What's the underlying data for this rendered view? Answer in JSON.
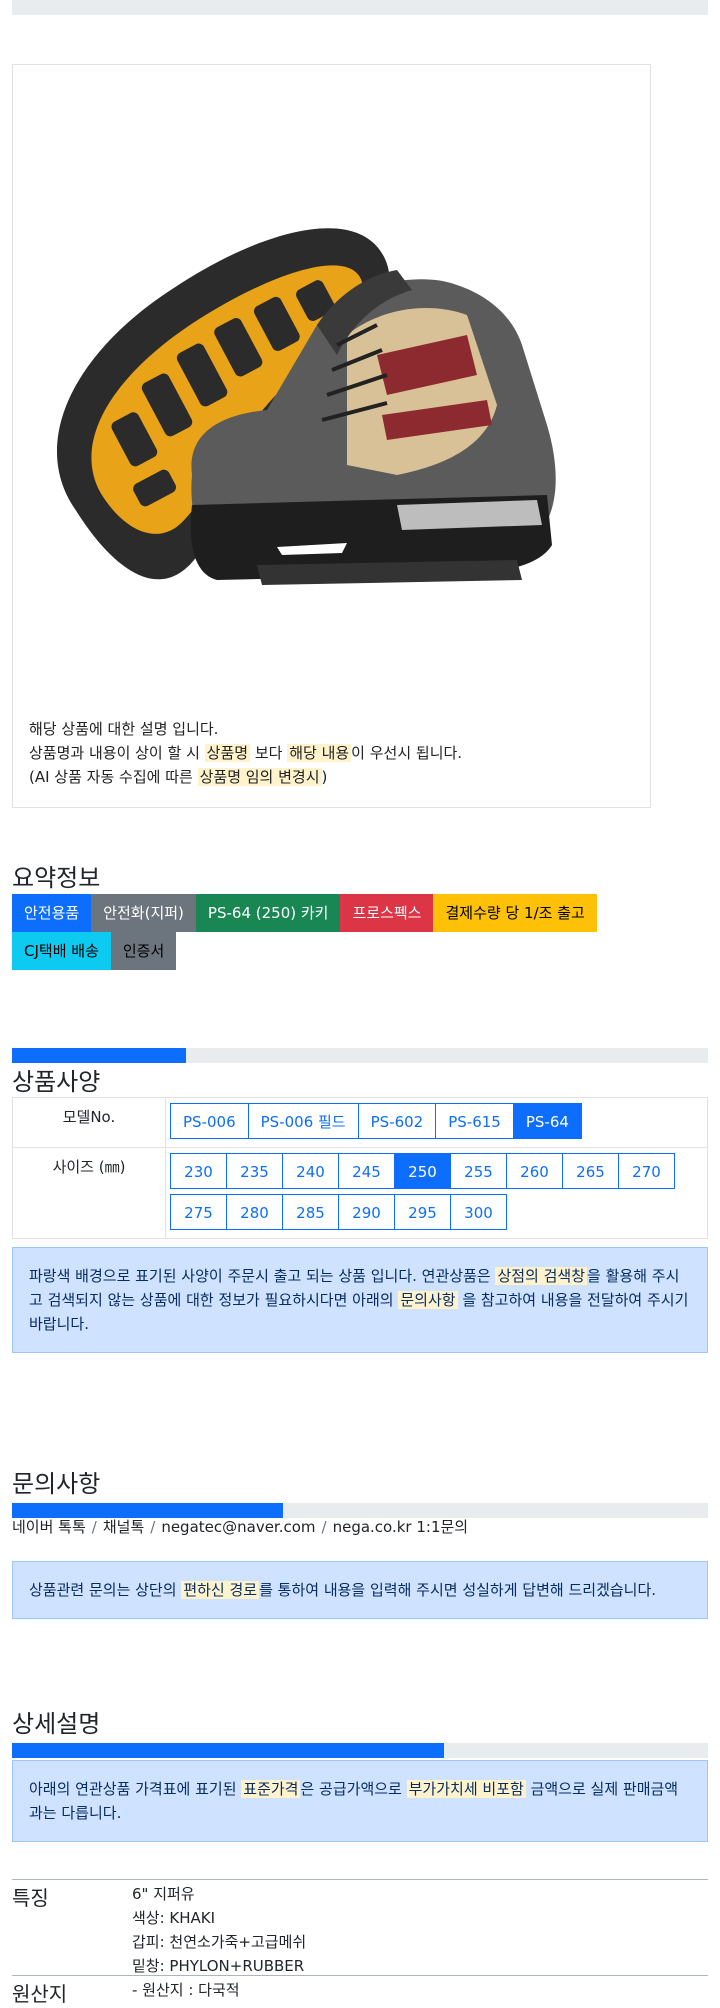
{
  "product": {
    "image_alt": "",
    "desc_line1": "해당 상품에 대한 설명 입니다.",
    "desc_line2_a": "상품명과 내용이 상이 할 시 ",
    "desc_line2_hl1": "상품명",
    "desc_line2_b": " 보다 ",
    "desc_line2_hl2": "해당 내용",
    "desc_line2_c": "이 우선시 됩니다.",
    "desc_line3_a": "(AI 상품 자동 수집에 따른 ",
    "desc_line3_hl": "상품명 임의 변경시",
    "desc_line3_b": ")"
  },
  "summary": {
    "title": "요약정보",
    "badges": [
      {
        "label": "안전용품",
        "color": "#0d6efd"
      },
      {
        "label": "안전화(지퍼)",
        "color": "#6c757d"
      },
      {
        "label": "PS-64 (250) 카키",
        "color": "#198754"
      },
      {
        "label": "프로스펙스",
        "color": "#dc3545"
      },
      {
        "label": "결제수량 당 1/조 출고",
        "color": "#ffc107"
      },
      {
        "label": "CJ택배 배송",
        "color": "#0dcaf0"
      },
      {
        "label": "인증서",
        "color": "#6c757d"
      }
    ]
  },
  "spec": {
    "title": "상품사양",
    "progress": 0.25,
    "model_label": "모델No.",
    "models": [
      "PS-006",
      "PS-006 필드",
      "PS-602",
      "PS-615",
      "PS-64"
    ],
    "model_selected": "PS-64",
    "size_label": "사이즈 (㎜)",
    "sizes": [
      "230",
      "235",
      "240",
      "245",
      "250",
      "255",
      "260",
      "265",
      "270",
      "275",
      "280",
      "285",
      "290",
      "295",
      "300"
    ],
    "size_selected": "250",
    "notice_a": "파랑색 배경으로 표기된 사양이 주문시 출고 되는 상품 입니다. 연관상품은 ",
    "notice_hl1": "상점의 검색창",
    "notice_b": "을 활용해 주시고 검색되지 않는 상품에 대한 정보가 필요하시다면 아래의 ",
    "notice_hl2": "문의사항",
    "notice_c": " 을 참고하여 내용을 전달하여 주시기 바랍니다."
  },
  "inquiry": {
    "title": "문의사항",
    "progress": 0.39,
    "contacts": [
      "네이버 톡톡",
      "채널톡",
      "negatec@naver.com",
      "nega.co.kr 1:1문의"
    ],
    "notice_a": "상품관련 문의는 상단의 ",
    "notice_hl": "편하신 경로",
    "notice_b": "를 통하여 내용을 입력해 주시면 성실하게 답변해 드리겠습니다."
  },
  "detail": {
    "title": "상세설명",
    "progress": 0.62,
    "notice_a": "아래의 연관상품 가격표에 표기된 ",
    "notice_hl1": "표준가격",
    "notice_b": "은 공급가액으로 ",
    "notice_hl2": "부가가치세 비포함",
    "notice_c": " 금액으로 실제 판매금액과는 다릅니다.",
    "features_label": "특징",
    "features": [
      "6\" 지퍼유",
      "색상: KHAKI",
      "갑피: 천연소가죽+고급메쉬",
      "밑창: PHYLON+RUBBER"
    ],
    "origin_label": "원산지",
    "origin_value": "- 원산지 : 다국적"
  }
}
